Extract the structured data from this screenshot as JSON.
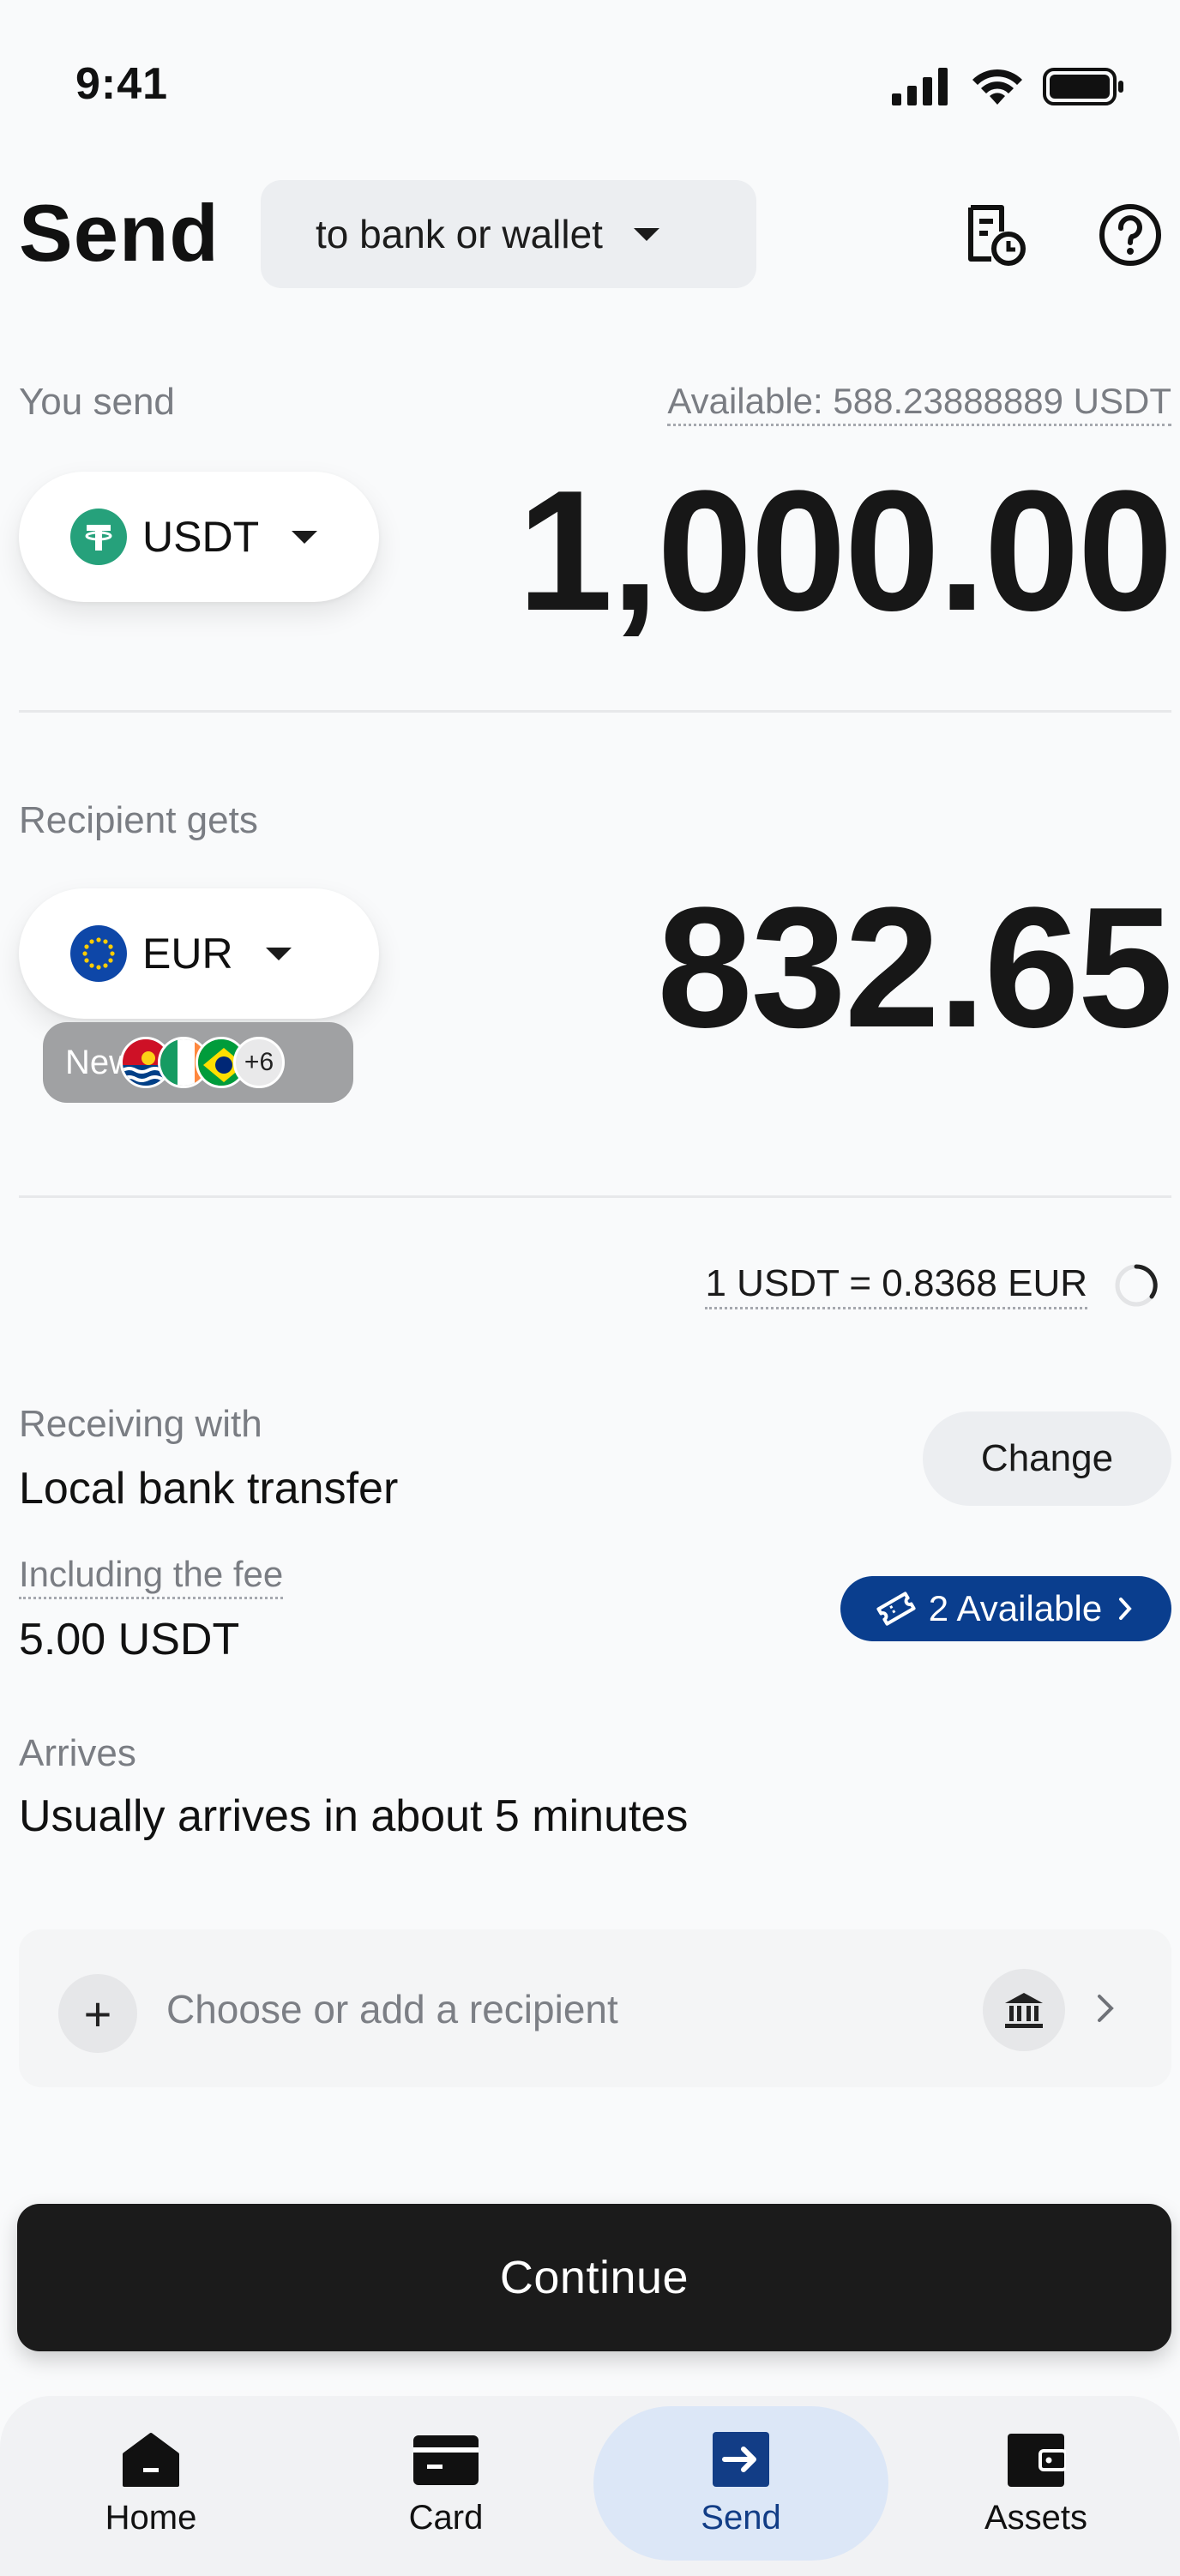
{
  "status_bar": {
    "time": "9:41"
  },
  "header": {
    "title": "Send",
    "mode_dropdown": "to bank or wallet",
    "icons": [
      "receipt-clock-icon",
      "help-circle-icon"
    ]
  },
  "send": {
    "label": "You send",
    "available": "Available: 588.23888889 USDT",
    "currency": "USDT",
    "currency_icon": "tether-icon",
    "amount": "1,000.00"
  },
  "recipient": {
    "label": "Recipient gets",
    "currency": "EUR",
    "currency_icon": "eu-flag-icon",
    "amount": "832.65",
    "new_badge": {
      "label": "New",
      "more": "+6"
    }
  },
  "rate": {
    "text": "1 USDT = 0.8368 EUR"
  },
  "receiving": {
    "label": "Receiving with",
    "value": "Local bank transfer",
    "change_label": "Change"
  },
  "fee": {
    "label": "Including the fee",
    "value": "5.00 USDT",
    "badge": "2 Available"
  },
  "arrives": {
    "label": "Arrives",
    "value": "Usually arrives in about 5 minutes"
  },
  "recipient_picker": {
    "placeholder": "Choose or add a recipient"
  },
  "continue_label": "Continue",
  "tabs": [
    {
      "label": "Home",
      "icon": "home-icon"
    },
    {
      "label": "Card",
      "icon": "card-icon"
    },
    {
      "label": "Send",
      "icon": "send-icon",
      "active": true
    },
    {
      "label": "Assets",
      "icon": "wallet-icon"
    }
  ],
  "colors": {
    "accent_blue": "#0a3e8e",
    "active_tab_bg": "#dce7f7",
    "tether_green": "#26a17b",
    "button_dark": "#1b1b1b"
  }
}
